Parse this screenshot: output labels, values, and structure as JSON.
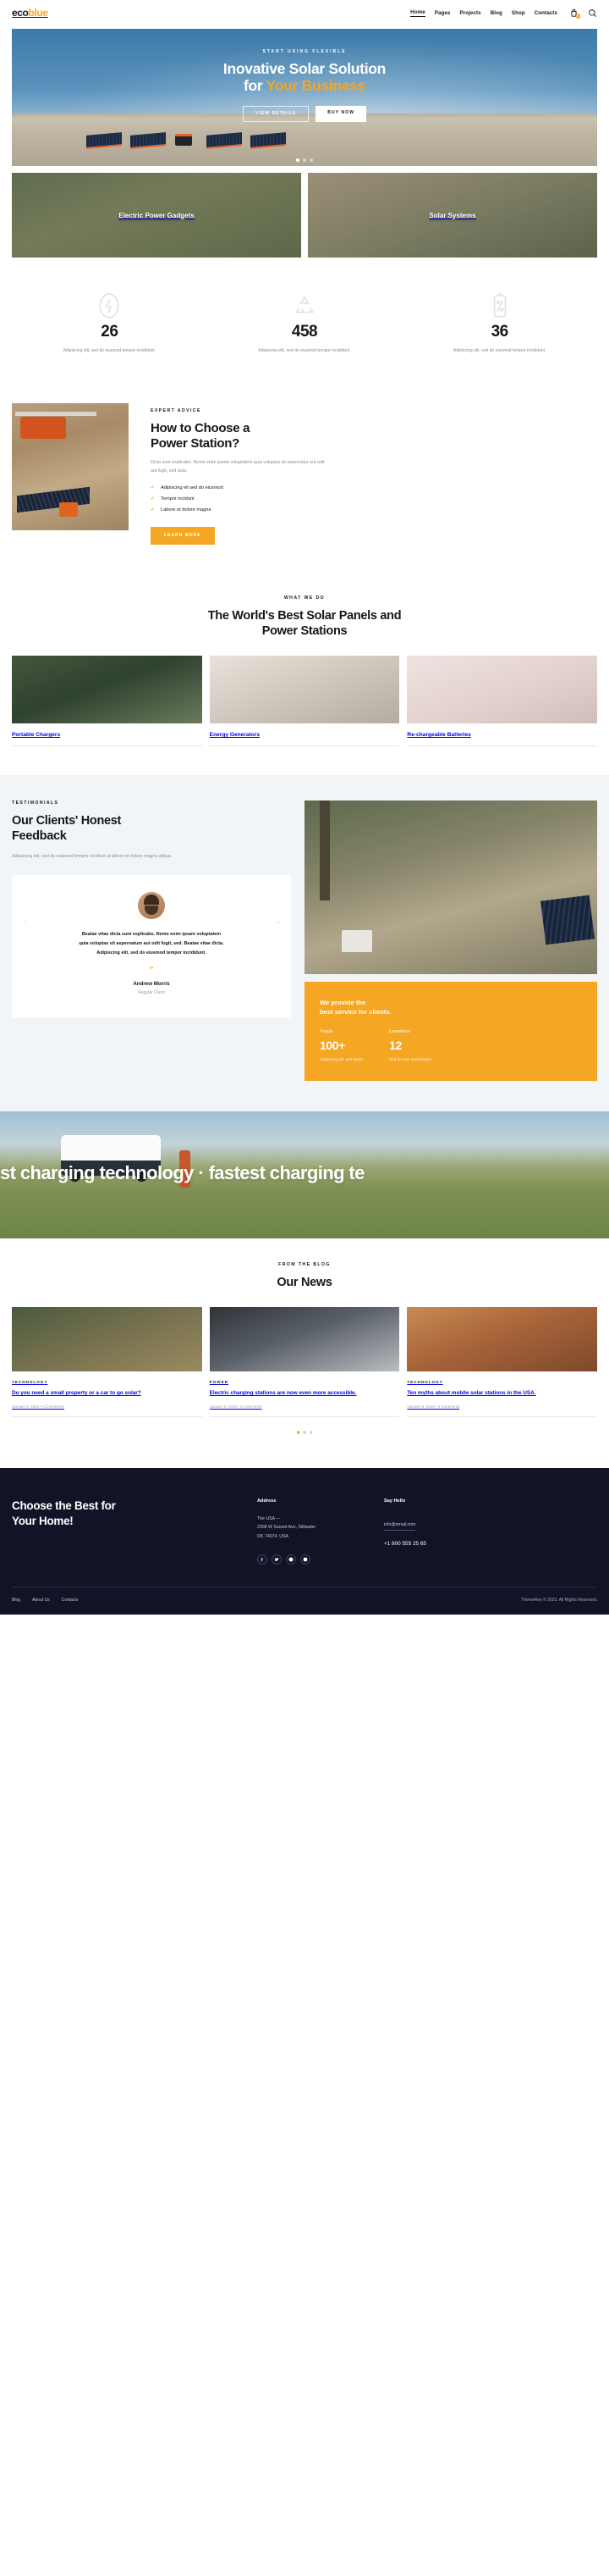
{
  "header": {
    "logo_eco": "eco",
    "logo_blue": "blue",
    "nav": [
      {
        "label": "Home",
        "active": true
      },
      {
        "label": "Pages",
        "active": false
      },
      {
        "label": "Projects",
        "active": false
      },
      {
        "label": "Blog",
        "active": false
      },
      {
        "label": "Shop",
        "active": false
      },
      {
        "label": "Contacts",
        "active": false
      }
    ],
    "cart_count": "0",
    "cart_icon": "shopping-bag-icon",
    "search_icon": "search-icon"
  },
  "hero": {
    "eyebrow": "START USING FLEXIBLE",
    "title_line1": "Inovative Solar Solution",
    "title_line2_plain": "for ",
    "title_line2_accent": "Your Business",
    "btn_primary": "VIEW DETAILS",
    "btn_secondary": "BUY NOW",
    "slides": 3,
    "active_slide": 1
  },
  "categories": [
    {
      "label": "Electric Power Gadgets"
    },
    {
      "label": "Solar Systems"
    }
  ],
  "stats": [
    {
      "icon": "lightning-bolt-icon",
      "number": "26",
      "text": "Adipiscing elit, sed do eiusmod tempor incididunt."
    },
    {
      "icon": "recycle-icon",
      "number": "458",
      "text": "Adipiscing elit, sed do eiusmod tempor incididunt."
    },
    {
      "icon": "battery-percent-icon",
      "number": "36",
      "text": "Adipiscing elit, sed do eiusmod tempor incididunt."
    }
  ],
  "advice": {
    "eyebrow": "EXPERT ADVICE",
    "title_line1": "How to Choose a",
    "title_line2": "Power Station?",
    "text": "Dicta sunt explicabo. Nemo enim ipsam voluptatem quia voluptas sit aspernatur aut odit aut fugit, sed quia.",
    "bullets": [
      "Adipiscing eli sed do eiusmod",
      "Tempor incidunt",
      "Labore et dolore magna"
    ],
    "cta": "LEARN MORE"
  },
  "services": {
    "eyebrow": "WHAT WE DO",
    "title_line1": "The World's Best Solar Panels and",
    "title_line2": "Power Stations",
    "cards": [
      {
        "name": "Portable Chargers"
      },
      {
        "name": "Energy Generators"
      },
      {
        "name": "Re-chargeable Batteries"
      }
    ]
  },
  "testimonials": {
    "eyebrow": "TESTIMONIALS",
    "title_line1": "Our Clients' Honest",
    "title_line2": "Feedback",
    "subtitle": "Adipiscing elit, sed do euismod tempor incidunt ut labore et dolore magna aliqua.",
    "prev_icon": "arrow-left-icon",
    "next_icon": "arrow-right-icon",
    "quote_line1": "Beatae vitae dicta sunt explicabo. Nemo enim ipsam voluptatem",
    "quote_line2": "quia voluptas sit aspernatum aut odit fugit, sed. Beatae vitae dicta.",
    "quote_line3": "Adipiscing elit, sed do eiusmod tempor incididunt.",
    "quote_mark": "”",
    "author": "Andrew Morris",
    "role": "Regular Client"
  },
  "promo": {
    "head_line1": "We provide the",
    "head_line2": "best service for clients.",
    "cols": [
      {
        "label": "People",
        "number": "100+",
        "text": "Adipiscing elit, sed totam."
      },
      {
        "label": "Experience",
        "number": "12",
        "text": "Sed do eius mod tempor."
      }
    ]
  },
  "band": {
    "marquee": "st charging technology · fastest charging te"
  },
  "blog": {
    "eyebrow": "FROM THE BLOG",
    "title": "Our News",
    "posts": [
      {
        "category": "TECHNOLOGY",
        "title": "Do you need a small property or a car to go solar?",
        "meta": "January 9, 2023  •  0 Comments"
      },
      {
        "category": "POWER",
        "title": "Electric charging stations are now even more accessible.",
        "meta": "January 9, 2023  •  0 Comments"
      },
      {
        "category": "TECHNOLOGY",
        "title": "Ten myths about mobile solar stations in the USA.",
        "meta": "January 9, 2023  •  0 Comments"
      }
    ],
    "dots": 3,
    "active_dot": 1
  },
  "footer": {
    "cta_line1": "Choose the Best for",
    "cta_line2": "Your Home!",
    "address_title": "Address",
    "address_lines": [
      "The USA —",
      "2008 W Sunset Ave, Stillwater",
      "OK 74074, USA"
    ],
    "contact_title": "Say Hello",
    "email": "info@email.com",
    "phone": "+1 800 555 25 65",
    "socials": [
      "facebook-icon",
      "twitter-icon",
      "dribbble-icon",
      "instagram-icon"
    ],
    "nav": [
      "Blog",
      "About Us",
      "Contacts"
    ],
    "copyright": "ThemeRex © 2023. All Rights Reserved."
  }
}
